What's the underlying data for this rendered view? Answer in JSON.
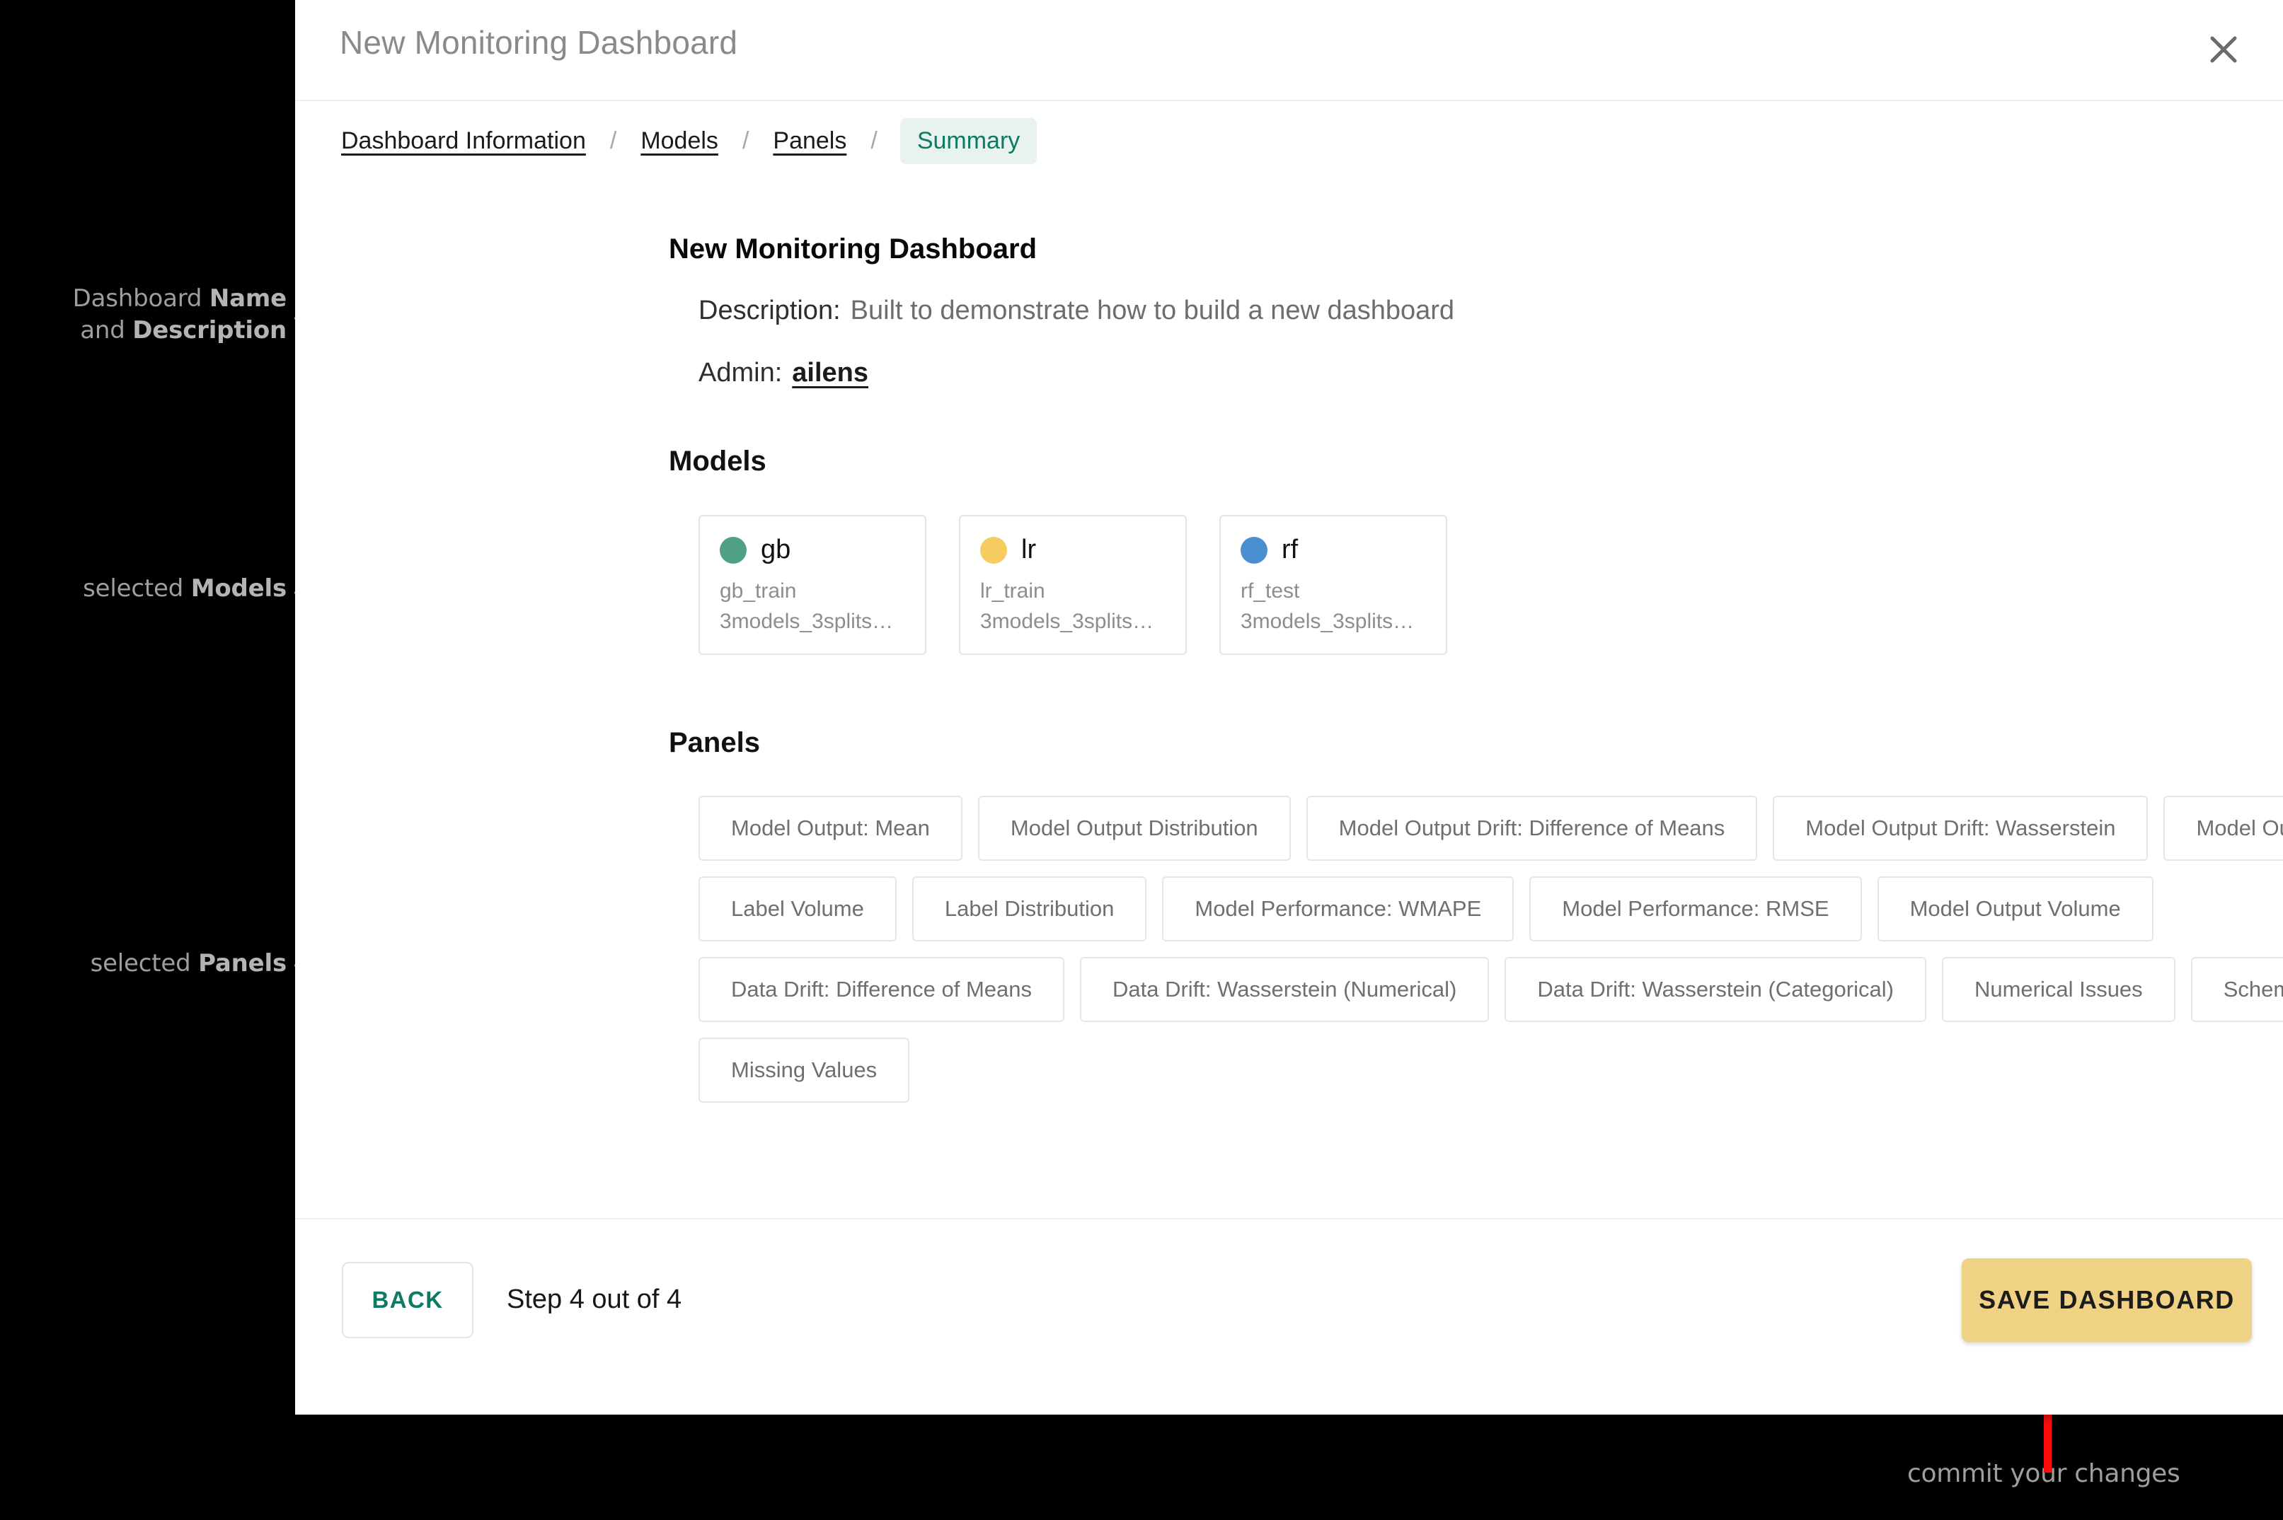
{
  "window": {
    "title": "New Monitoring Dashboard",
    "close_icon": "close-icon"
  },
  "steps": {
    "items": [
      {
        "label": "Dashboard Information",
        "active": false
      },
      {
        "label": "Models",
        "active": false
      },
      {
        "label": "Panels",
        "active": false
      },
      {
        "label": "Summary",
        "active": true
      }
    ],
    "separator": "/"
  },
  "summary": {
    "dashboard_name": "New Monitoring Dashboard",
    "description_label": "Description:",
    "description_value": "Built to demonstrate how to build a new dashboard",
    "admin_label": "Admin:",
    "admin_value": "ailens"
  },
  "models_section": {
    "heading": "Models",
    "cards": [
      {
        "name": "gb",
        "dataset": "gb_train",
        "project": "3models_3splits…",
        "color": "#4fa085"
      },
      {
        "name": "lr",
        "dataset": "lr_train",
        "project": "3models_3splits…",
        "color": "#f6cb5f"
      },
      {
        "name": "rf",
        "dataset": "rf_test",
        "project": "3models_3splits…",
        "color": "#4a8fd0"
      }
    ]
  },
  "panels_section": {
    "heading": "Panels",
    "chips": [
      "Model Output: Mean",
      "Model Output Distribution",
      "Model Output Drift: Difference of Means",
      "Model Output Drift: Wasserstein",
      "Model Output Volume",
      "Label Volume",
      "Label Distribution",
      "Model Performance: WMAPE",
      "Model Performance: RMSE",
      "Model Output Volume",
      "Data Drift: Difference of Means",
      "Data Drift: Wasserstein (Numerical)",
      "Data Drift: Wasserstein (Categorical)",
      "Numerical Issues",
      "Schema Mismatch",
      "Missing Values"
    ]
  },
  "footer": {
    "back_label": "BACK",
    "step_counter": "Step 4 out of 4",
    "save_label": "SAVE DASHBOARD"
  },
  "annotations": {
    "name_and_description": "Dashboard <b>Name</b><br>and <b>Description</b>",
    "selected_models": "selected <b>Models</b>",
    "selected_panels": "selected <b>Panels</b>",
    "commit": "commit your changes",
    "arrow_color": "#fb0d0d"
  }
}
